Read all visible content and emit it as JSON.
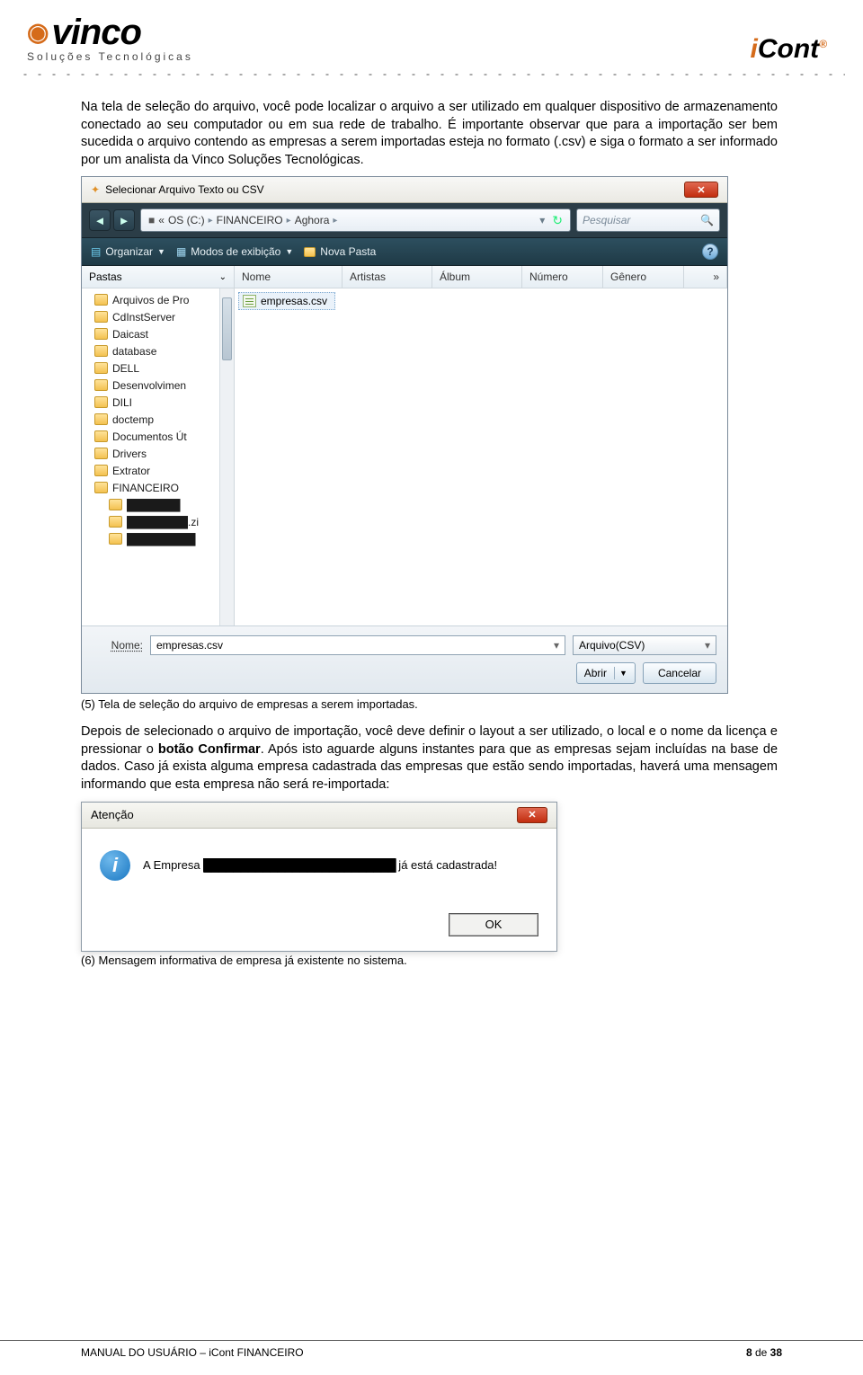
{
  "header": {
    "brand": "vinco",
    "tagline": "Soluções Tecnológicas",
    "product": "iCont",
    "tm": "®"
  },
  "paragraphs": {
    "p1": "Na tela de seleção do arquivo, você pode localizar o arquivo a ser utilizado em qualquer dispositivo de armazenamento conectado ao seu computador ou em sua rede de trabalho. É importante observar que para a importação ser bem sucedida o arquivo contendo as empresas a serem importadas esteja no formato (.csv) e siga o formato a ser informado por um analista da Vinco Soluções Tecnológicas.",
    "caption5": "(5) Tela de seleção do arquivo de empresas a serem importadas.",
    "p2a": "Depois de selecionado o arquivo de importação, você deve definir o layout a ser utilizado, o local e o nome da licença e pressionar o ",
    "p2b": "botão Confirmar",
    "p2c": ". Após isto aguarde alguns instantes para que as empresas sejam incluídas na base de dados. Caso já exista alguma empresa cadastrada das empresas que estão sendo importadas, haverá uma mensagem informando que esta empresa não será re-importada:",
    "caption6": "(6) Mensagem informativa de empresa já existente no sistema."
  },
  "file_dialog": {
    "title": "Selecionar Arquivo Texto ou CSV",
    "path": {
      "p0": "«",
      "p1": "OS (C:)",
      "p2": "FINANCEIRO",
      "p3": "Aghora",
      "sep": "▸"
    },
    "search_placeholder": "Pesquisar",
    "toolbar": {
      "organize": "Organizar",
      "views": "Modos de exibição",
      "newfolder": "Nova Pasta"
    },
    "tree_header": "Pastas",
    "folders": [
      "Arquivos de Pro",
      "CdInstServer",
      "Daicast",
      "database",
      "DELL",
      "Desenvolvimen",
      "DILI",
      "doctemp",
      "Documentos Út",
      "Drivers",
      "Extrator",
      "FINANCEIRO"
    ],
    "subfolders": [
      "███████",
      "████████.zi",
      "█████████"
    ],
    "columns": [
      "Nome",
      "Artistas",
      "Álbum",
      "Número",
      "Gênero"
    ],
    "file": "empresas.csv",
    "more": "»",
    "filename_label": "Nome:",
    "filename_value": "empresas.csv",
    "filetype": "Arquivo(CSV)",
    "open": "Abrir",
    "cancel": "Cancelar"
  },
  "msg_dialog": {
    "title": "Atenção",
    "text_a": "A Empresa ",
    "text_b": "  já está cadastrada!",
    "ok": "OK"
  },
  "footer": {
    "left": "MANUAL DO USUÁRIO – iCont FINANCEIRO",
    "page_cur": "8",
    "page_sep": " de ",
    "page_tot": "38"
  }
}
